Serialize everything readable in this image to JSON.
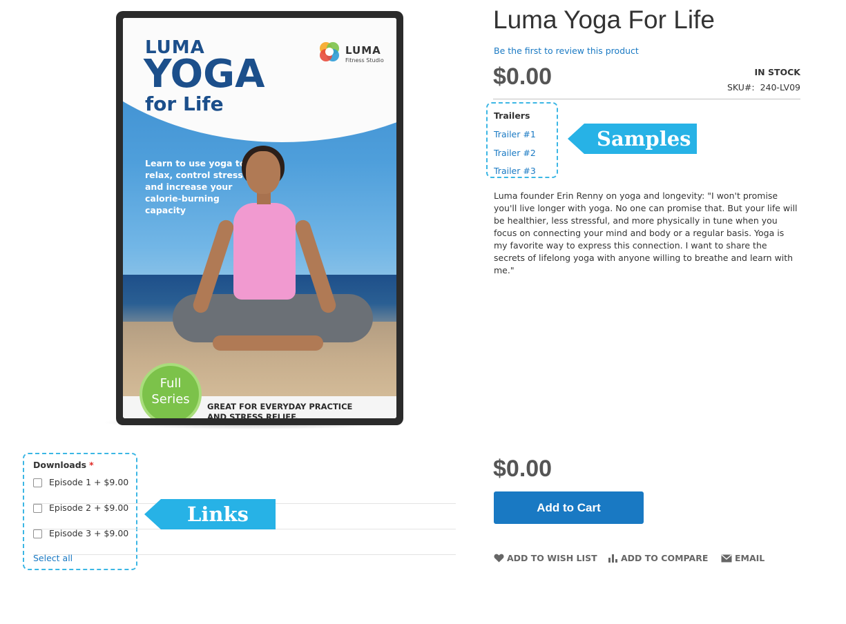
{
  "product": {
    "name": "Luma Yoga For Life",
    "review_link": "Be the first to review this product",
    "price": "$0.00",
    "stock_status": "IN STOCK",
    "sku_label": "SKU#:",
    "sku_value": "240-LV09",
    "description": "Luma founder Erin Renny on yoga and longevity: \"I won't promise you'll live longer with yoga. No one can promise that. But your life will be healthier, less stressful, and more physically in tune when you focus on connecting your mind and body or a regular basis. Yoga is my favorite way to express this connection. I want to share the secrets of lifelong yoga with anyone willing to breathe and learn with me.\""
  },
  "cover_art": {
    "title_small": "LUMA",
    "title_big": "YOGA",
    "title_life": "for Life",
    "brand_name": "LUMA",
    "brand_sub": "Fitness Studio",
    "tagline": "Learn to use yoga to relax, control stress and increase your calorie-burning capacity",
    "badge_line1": "Full",
    "badge_line2": "Series",
    "footer_line1": "GREAT FOR EVERYDAY PRACTICE",
    "footer_line2": "AND STRESS RELIEF."
  },
  "samples": {
    "title": "Trailers",
    "items": [
      "Trailer #1",
      "Trailer #2",
      "Trailer #3"
    ]
  },
  "downloads": {
    "title": "Downloads",
    "required_mark": "*",
    "items": [
      "Episode 1 + $9.00",
      "Episode 2 + $9.00",
      "Episode 3 + $9.00"
    ],
    "select_all": "Select all"
  },
  "annotations": {
    "samples_callout": "Samples",
    "links_callout": "Links",
    "highlight_color": "#3bb6e4",
    "callout_color": "#27b2e6"
  },
  "purchase": {
    "final_price": "$0.00",
    "add_to_cart": "Add to Cart",
    "actions": [
      {
        "label": "ADD TO WISH LIST",
        "icon": "heart-icon"
      },
      {
        "label": "ADD TO COMPARE",
        "icon": "compare-icon"
      },
      {
        "label": "EMAIL",
        "icon": "envelope-icon"
      }
    ]
  },
  "colors": {
    "link": "#1979c3",
    "button": "#1979c3",
    "price": "#555555"
  }
}
